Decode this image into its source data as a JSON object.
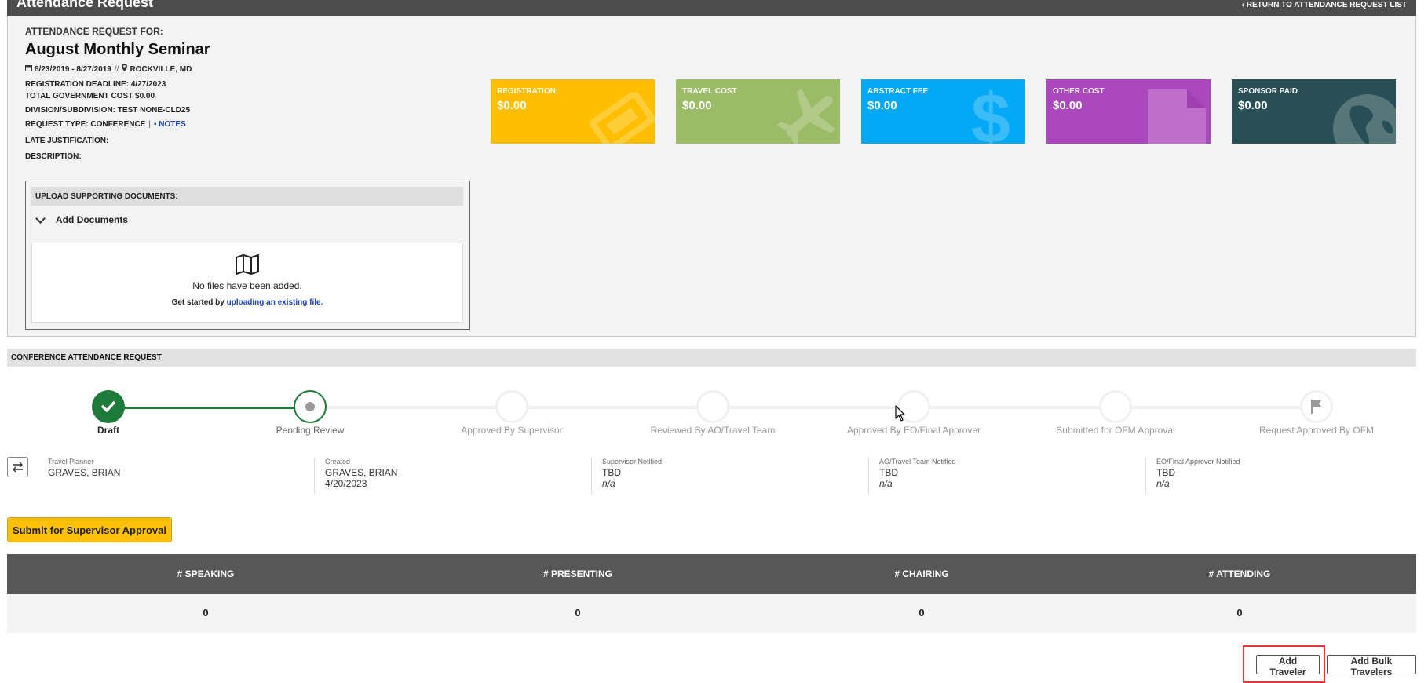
{
  "header": {
    "title": "Attendance Request",
    "return_link": "RETURN TO ATTENDANCE REQUEST LIST"
  },
  "request": {
    "for_label": "ATTENDANCE REQUEST FOR:",
    "event_title": "August Monthly Seminar",
    "dates": "8/23/2019 - 8/27/2019",
    "date_sep": "//",
    "location": "ROCKVILLE, MD",
    "registration_deadline": "REGISTRATION DEADLINE: 4/27/2023",
    "total_cost": "TOTAL GOVERNMENT COST $0.00",
    "division": "DIVISION/SUBDIVISION: TEST NONE-CLD25",
    "request_type": "REQUEST TYPE: CONFERENCE",
    "pipe": "|",
    "notes_link": "NOTES",
    "late_justification": "LATE JUSTIFICATION:",
    "description": "DESCRIPTION:"
  },
  "upload": {
    "header": "UPLOAD SUPPORTING DOCUMENTS:",
    "add_documents": "Add Documents",
    "no_files": "No files have been added.",
    "get_started_prefix": "Get started by",
    "get_started_link": "uploading an existing file."
  },
  "cost_cards": [
    {
      "label": "REGISTRATION",
      "value": "$0.00",
      "color": "#ffbf00",
      "icon": "ticket-icon"
    },
    {
      "label": "TRAVEL COST",
      "value": "$0.00",
      "color": "#9cbb66",
      "icon": "airplane-icon"
    },
    {
      "label": "ABSTRACT FEE",
      "value": "$0.00",
      "color": "#03a9f4",
      "icon": "dollar-icon"
    },
    {
      "label": "OTHER COST",
      "value": "$0.00",
      "color": "#ab47bc",
      "icon": "document-icon"
    },
    {
      "label": "SPONSOR PAID",
      "value": "$0.00",
      "color": "#274f55",
      "icon": "globe-icon"
    }
  ],
  "conference": {
    "header": "CONFERENCE ATTENDANCE REQUEST",
    "steps": [
      {
        "label": "Draft",
        "state": "complete"
      },
      {
        "label": "Pending Review",
        "state": "current"
      },
      {
        "label": "Approved By Supervisor",
        "state": "pending"
      },
      {
        "label": "Reviewed By AO/Travel Team",
        "state": "pending"
      },
      {
        "label": "Approved By EO/Final Approver",
        "state": "pending"
      },
      {
        "label": "Submitted for OFM Approval",
        "state": "pending"
      },
      {
        "label": "Request Approved By OFM",
        "state": "pending"
      }
    ],
    "accent_color": "#1e7a3a"
  },
  "info": {
    "travel_planner": {
      "label": "Travel Planner",
      "name": "GRAVES, BRIAN"
    },
    "created": {
      "label": "Created",
      "name": "GRAVES, BRIAN",
      "date": "4/20/2023"
    },
    "supervisor": {
      "label": "Supervisor Notified",
      "name": "TBD",
      "date": "n/a"
    },
    "ao_travel": {
      "label": "AO/Travel Team Notified",
      "name": "TBD",
      "date": "n/a"
    },
    "eo_final": {
      "label": "EO/Final Approver Notified",
      "name": "TBD",
      "date": "n/a"
    }
  },
  "actions": {
    "submit": "Submit for Supervisor Approval",
    "add_traveler": "Add Traveler",
    "add_bulk": "Add Bulk Travelers"
  },
  "counts": {
    "headers": [
      "# SPEAKING",
      "# PRESENTING",
      "# CHAIRING",
      "# ATTENDING"
    ],
    "values": [
      "0",
      "0",
      "0",
      "0"
    ]
  }
}
